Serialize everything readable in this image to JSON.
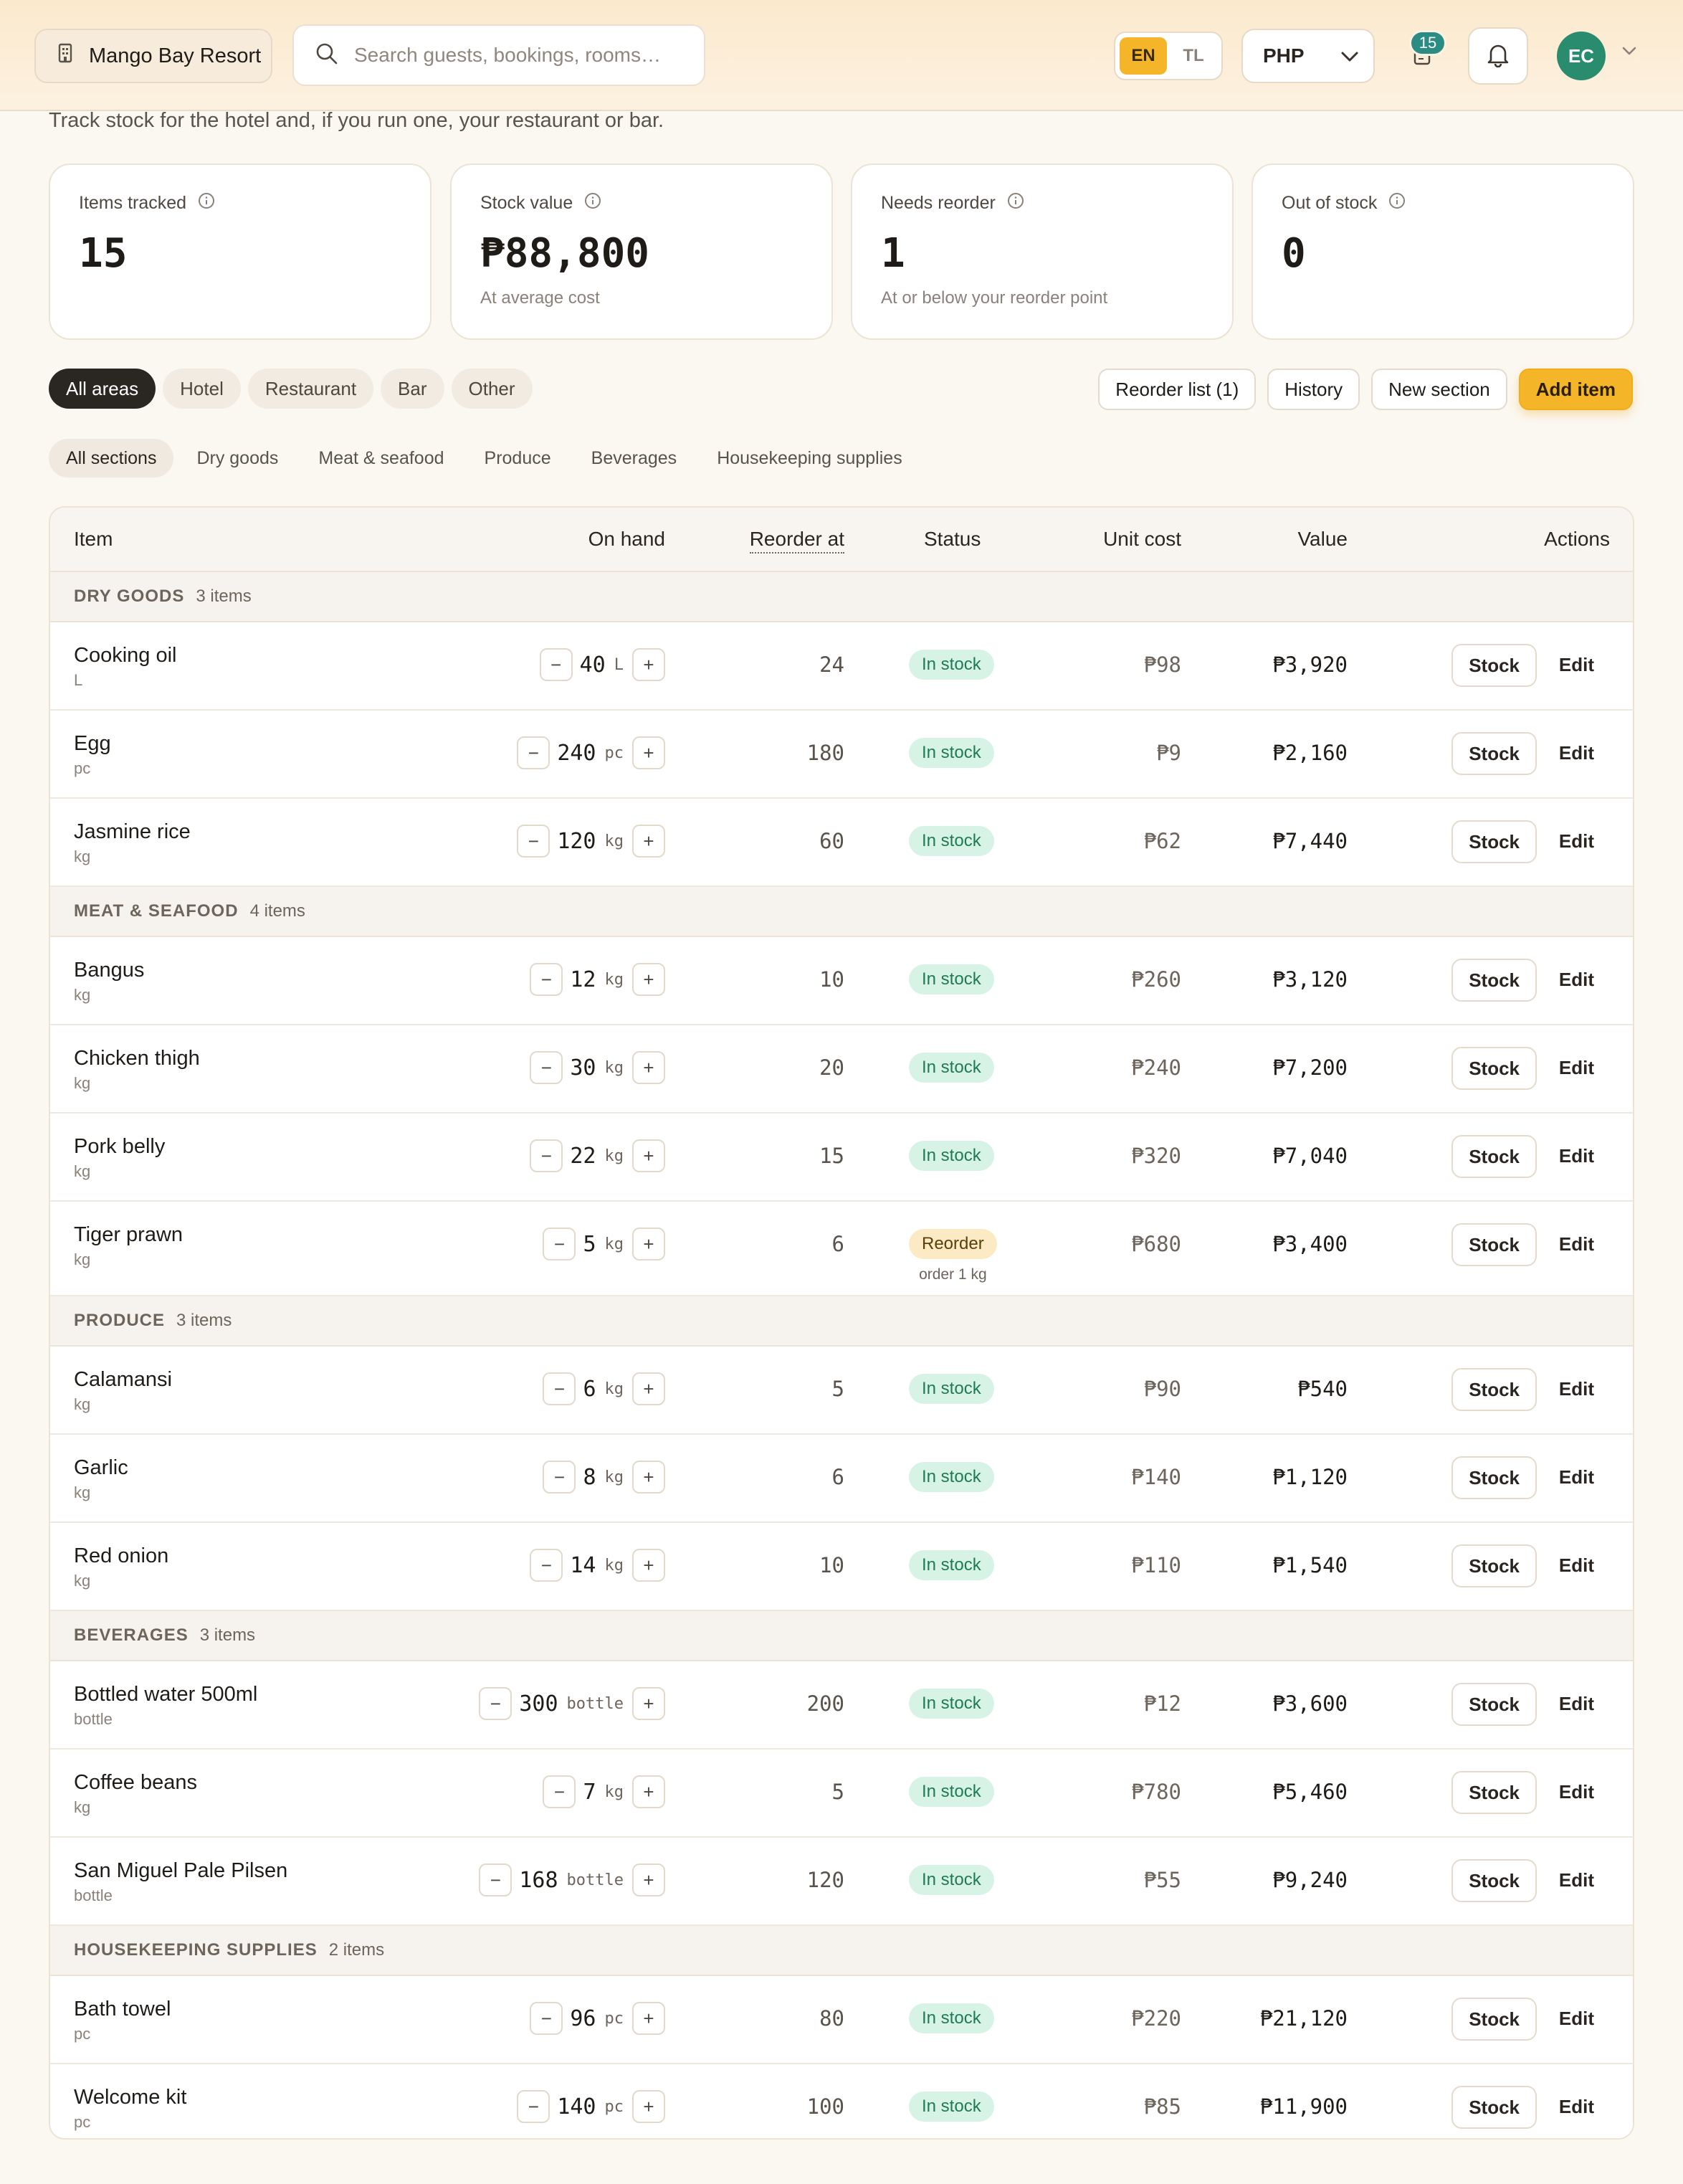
{
  "header": {
    "property": "Mango Bay Resort",
    "search_placeholder": "Search guests, bookings, rooms…",
    "lang_en": "EN",
    "lang_tl": "TL",
    "currency": "PHP",
    "tasks_badge": "15",
    "avatar_initials": "EC"
  },
  "page": {
    "subtitle": "Track stock for the hotel and, if you run one, your restaurant or bar."
  },
  "stats": [
    {
      "label": "Items tracked",
      "value": "15",
      "note": ""
    },
    {
      "label": "Stock value",
      "value": "₱88,800",
      "note": "At average cost"
    },
    {
      "label": "Needs reorder",
      "value": "1",
      "note": "At or below your reorder point"
    },
    {
      "label": "Out of stock",
      "value": "0",
      "note": ""
    }
  ],
  "areas": [
    "All areas",
    "Hotel",
    "Restaurant",
    "Bar",
    "Other"
  ],
  "toolbar": {
    "reorder_list": "Reorder list (1)",
    "history": "History",
    "new_section": "New section",
    "add_item": "Add item"
  },
  "section_tabs": [
    "All sections",
    "Dry goods",
    "Meat & seafood",
    "Produce",
    "Beverages",
    "Housekeeping supplies"
  ],
  "table": {
    "headers": {
      "item": "Item",
      "on_hand": "On hand",
      "reorder_at": "Reorder at",
      "status": "Status",
      "unit_cost": "Unit cost",
      "value": "Value",
      "actions": "Actions"
    },
    "stock_label": "Stock",
    "edit_label": "Edit",
    "groups": [
      {
        "name": "DRY GOODS",
        "count": "3 items",
        "items": [
          {
            "name": "Cooking oil",
            "unit": "L",
            "qty": "40",
            "reorder": "24",
            "status": "In stock",
            "note": "",
            "cost": "₱98",
            "value": "₱3,920"
          },
          {
            "name": "Egg",
            "unit": "pc",
            "qty": "240",
            "reorder": "180",
            "status": "In stock",
            "note": "",
            "cost": "₱9",
            "value": "₱2,160"
          },
          {
            "name": "Jasmine rice",
            "unit": "kg",
            "qty": "120",
            "reorder": "60",
            "status": "In stock",
            "note": "",
            "cost": "₱62",
            "value": "₱7,440"
          }
        ]
      },
      {
        "name": "MEAT & SEAFOOD",
        "count": "4 items",
        "items": [
          {
            "name": "Bangus",
            "unit": "kg",
            "qty": "12",
            "reorder": "10",
            "status": "In stock",
            "note": "",
            "cost": "₱260",
            "value": "₱3,120"
          },
          {
            "name": "Chicken thigh",
            "unit": "kg",
            "qty": "30",
            "reorder": "20",
            "status": "In stock",
            "note": "",
            "cost": "₱240",
            "value": "₱7,200"
          },
          {
            "name": "Pork belly",
            "unit": "kg",
            "qty": "22",
            "reorder": "15",
            "status": "In stock",
            "note": "",
            "cost": "₱320",
            "value": "₱7,040"
          },
          {
            "name": "Tiger prawn",
            "unit": "kg",
            "qty": "5",
            "reorder": "6",
            "status": "Reorder",
            "note": "order 1 kg",
            "cost": "₱680",
            "value": "₱3,400"
          }
        ]
      },
      {
        "name": "PRODUCE",
        "count": "3 items",
        "items": [
          {
            "name": "Calamansi",
            "unit": "kg",
            "qty": "6",
            "reorder": "5",
            "status": "In stock",
            "note": "",
            "cost": "₱90",
            "value": "₱540"
          },
          {
            "name": "Garlic",
            "unit": "kg",
            "qty": "8",
            "reorder": "6",
            "status": "In stock",
            "note": "",
            "cost": "₱140",
            "value": "₱1,120"
          },
          {
            "name": "Red onion",
            "unit": "kg",
            "qty": "14",
            "reorder": "10",
            "status": "In stock",
            "note": "",
            "cost": "₱110",
            "value": "₱1,540"
          }
        ]
      },
      {
        "name": "BEVERAGES",
        "count": "3 items",
        "items": [
          {
            "name": "Bottled water 500ml",
            "unit": "bottle",
            "qty": "300",
            "reorder": "200",
            "status": "In stock",
            "note": "",
            "cost": "₱12",
            "value": "₱3,600"
          },
          {
            "name": "Coffee beans",
            "unit": "kg",
            "qty": "7",
            "reorder": "5",
            "status": "In stock",
            "note": "",
            "cost": "₱780",
            "value": "₱5,460"
          },
          {
            "name": "San Miguel Pale Pilsen",
            "unit": "bottle",
            "qty": "168",
            "reorder": "120",
            "status": "In stock",
            "note": "",
            "cost": "₱55",
            "value": "₱9,240"
          }
        ]
      },
      {
        "name": "HOUSEKEEPING SUPPLIES",
        "count": "2 items",
        "items": [
          {
            "name": "Bath towel",
            "unit": "pc",
            "qty": "96",
            "reorder": "80",
            "status": "In stock",
            "note": "",
            "cost": "₱220",
            "value": "₱21,120"
          },
          {
            "name": "Welcome kit",
            "unit": "pc",
            "qty": "140",
            "reorder": "100",
            "status": "In stock",
            "note": "",
            "cost": "₱85",
            "value": "₱11,900"
          }
        ]
      }
    ]
  },
  "colors": {
    "accent": "#f5b529",
    "in_stock_bg": "#d7f3e6",
    "reorder_bg": "#fbeac4",
    "avatar": "#2a8c6e"
  }
}
